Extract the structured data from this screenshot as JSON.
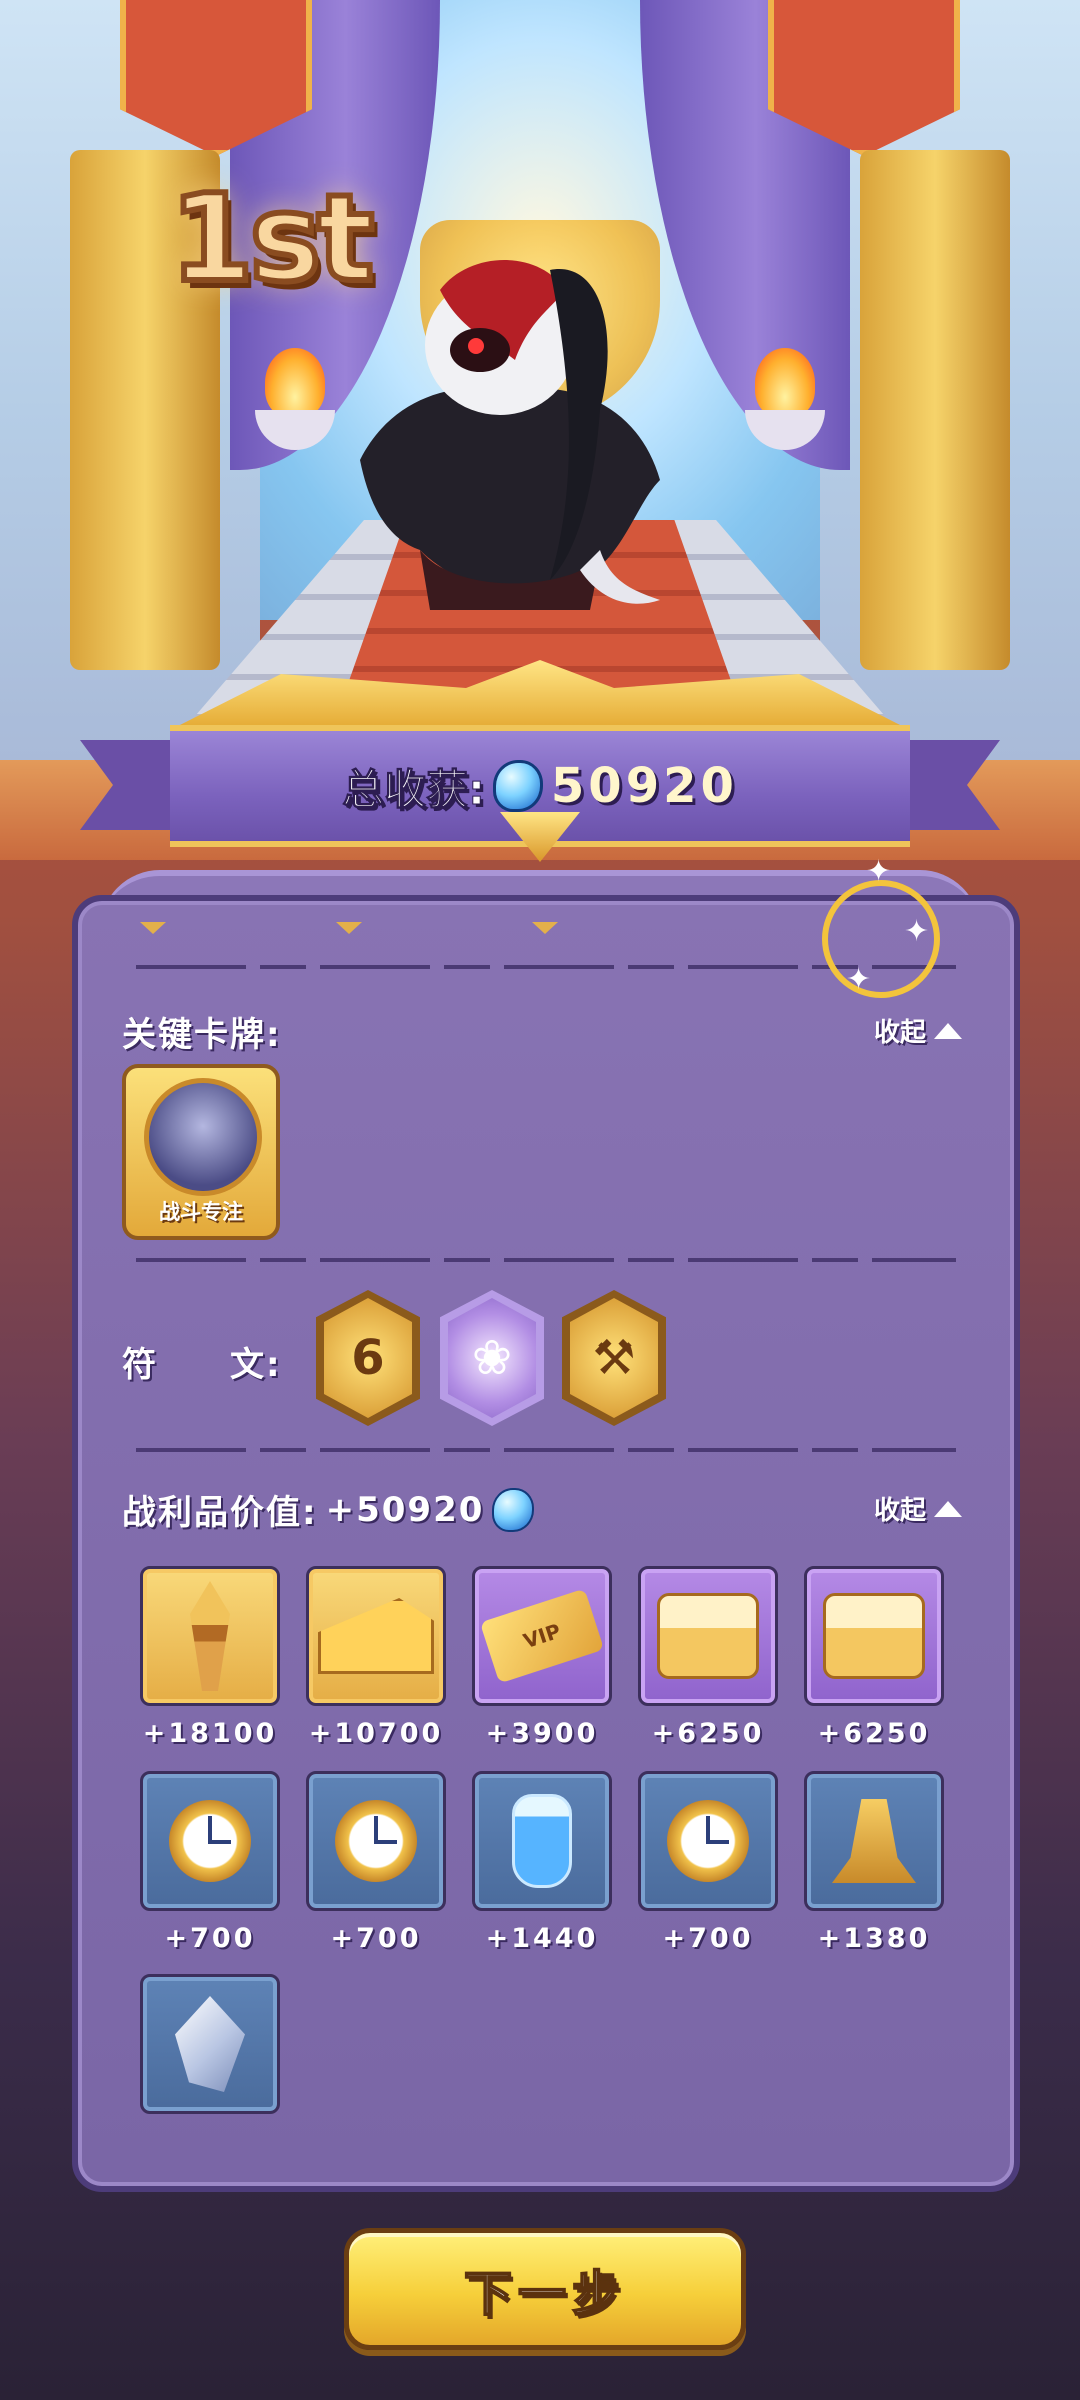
{
  "result": {
    "place": "1st",
    "total_label": "总收获:",
    "total_value": "50920"
  },
  "key_cards": {
    "label": "关键卡牌:",
    "collapse_label": "收起",
    "cards": [
      {
        "name": "战斗专注"
      }
    ]
  },
  "runes": {
    "label": "符　　文:",
    "items": [
      {
        "icon": "spiral-six-rune-icon",
        "glyph": "6"
      },
      {
        "icon": "rose-rune-icon",
        "glyph": "❀"
      },
      {
        "icon": "hammer-rune-icon",
        "glyph": "⚒"
      }
    ]
  },
  "loot": {
    "label": "战利品价值:",
    "value": "+50920",
    "collapse_label": "收起",
    "items": [
      {
        "icon": "dagger-icon",
        "rarity": "gold",
        "amount": "+18100"
      },
      {
        "icon": "cheese-icon",
        "rarity": "gold",
        "amount": "+10700"
      },
      {
        "icon": "vip-ticket-icon",
        "rarity": "purple",
        "amount": "+3900",
        "ticket_text": "VIP"
      },
      {
        "icon": "cake-icon",
        "rarity": "purple",
        "amount": "+6250"
      },
      {
        "icon": "cake-icon",
        "rarity": "purple",
        "amount": "+6250"
      },
      {
        "icon": "alarm-clock-icon",
        "rarity": "blue",
        "amount": "+700"
      },
      {
        "icon": "alarm-clock-icon",
        "rarity": "blue",
        "amount": "+700"
      },
      {
        "icon": "potion-bottle-icon",
        "rarity": "blue",
        "amount": "+1440"
      },
      {
        "icon": "alarm-clock-icon",
        "rarity": "blue",
        "amount": "+700"
      },
      {
        "icon": "bell-icon",
        "rarity": "blue",
        "amount": "+1380"
      },
      {
        "icon": "crystal-icon",
        "rarity": "blue",
        "amount": ""
      }
    ]
  },
  "next_button": {
    "label": "下一步"
  },
  "colors": {
    "gold": "#e5ad45",
    "purple": "#8f63cc",
    "blue": "#4a6b9c",
    "panel": "#7a66a6"
  }
}
